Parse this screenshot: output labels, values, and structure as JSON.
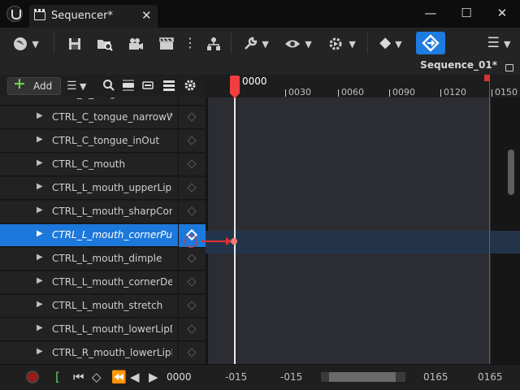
{
  "window": {
    "tab_title": "Sequencer*",
    "tab_close": "✕",
    "minimize": "—",
    "maximize": "☐",
    "close": "✕"
  },
  "toolbar": {
    "sequence_name": "Sequence_01*"
  },
  "left_toolbar": {
    "add_label": "Add"
  },
  "tracks": [
    {
      "label": "CTRL_C_tongue"
    },
    {
      "label": "CTRL_C_tongue_narrowWide"
    },
    {
      "label": "CTRL_C_tongue_inOut"
    },
    {
      "label": "CTRL_C_mouth"
    },
    {
      "label": "CTRL_L_mouth_upperLipRaise"
    },
    {
      "label": "CTRL_L_mouth_sharpCornerPull"
    },
    {
      "label": "CTRL_L_mouth_cornerPull"
    },
    {
      "label": "CTRL_L_mouth_dimple"
    },
    {
      "label": "CTRL_L_mouth_cornerDepress"
    },
    {
      "label": "CTRL_L_mouth_stretch"
    },
    {
      "label": "CTRL_L_mouth_lowerLipDepress"
    },
    {
      "label": "CTRL_R_mouth_lowerLipDepress"
    }
  ],
  "selected_track_index": 6,
  "timeline": {
    "current_frame": "0000",
    "ticks": [
      "0030",
      "0060",
      "0090",
      "0120",
      "0150"
    ]
  },
  "bottom": {
    "current_time": "0000",
    "view_start": "-015",
    "view_start_2": "-015",
    "view_end": "0165",
    "view_end_2": "0165"
  },
  "colors": {
    "accent": "#1e7be0",
    "playhead": "#f23e3e",
    "selected_row": "#1d78dc"
  }
}
